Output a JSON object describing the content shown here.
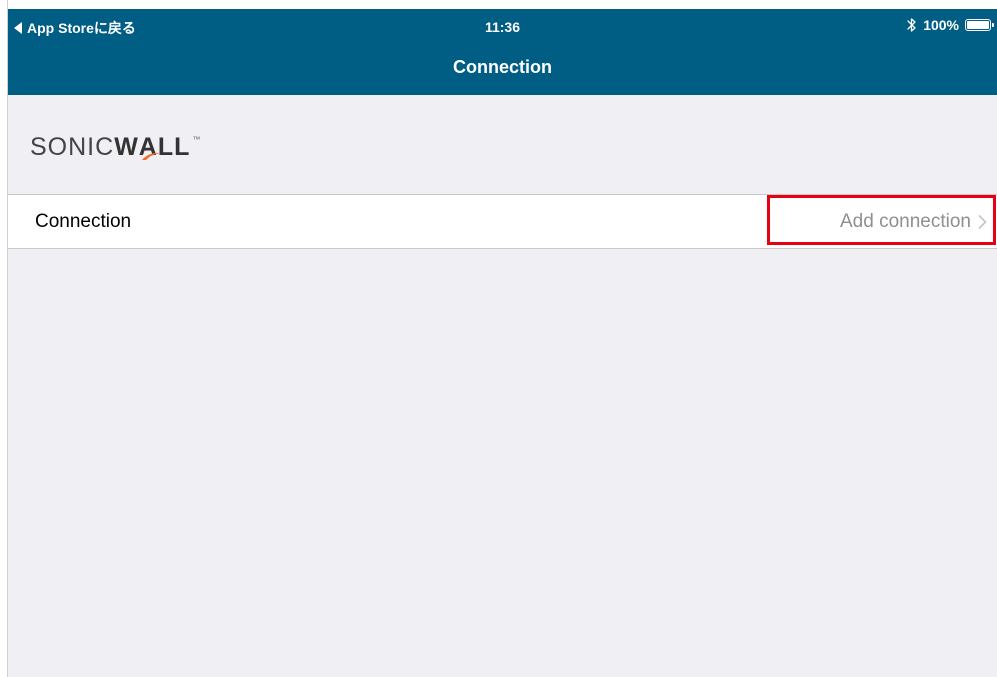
{
  "status_bar": {
    "back_label": "App Storeに戻る",
    "time": "11:36",
    "battery_percent": "100%",
    "bluetooth_icon": "bluetooth-icon",
    "battery_level": 1.0
  },
  "nav": {
    "title": "Connection"
  },
  "logo": {
    "text_light": "SONIC",
    "text_bold_w": "W",
    "text_bold_a": "A",
    "text_bold_rest": "LL",
    "trademark": "™"
  },
  "connection_row": {
    "label": "Connection",
    "detail": "Add connection",
    "chevron_icon": "chevron-right-icon"
  },
  "colors": {
    "header": "#005d84",
    "background": "#efeff4",
    "highlight": "#e60012",
    "logo_accent": "#f26b21"
  }
}
